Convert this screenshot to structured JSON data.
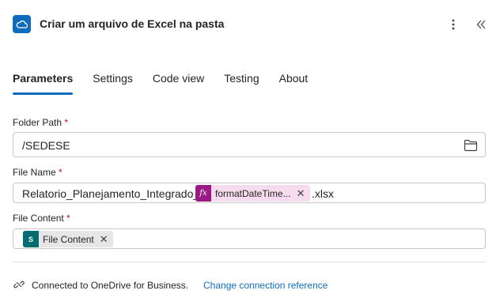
{
  "header": {
    "title": "Criar um arquivo de Excel na pasta",
    "app_icon": "onedrive-cloud-icon",
    "more_icon": "more-vertical-icon",
    "collapse_icon": "double-chevron-left-icon"
  },
  "tabs": [
    {
      "label": "Parameters",
      "active": true
    },
    {
      "label": "Settings",
      "active": false
    },
    {
      "label": "Code view",
      "active": false
    },
    {
      "label": "Testing",
      "active": false
    },
    {
      "label": "About",
      "active": false
    }
  ],
  "fields": {
    "folder_path": {
      "label": "Folder Path",
      "required_mark": "*",
      "value": "/SEDESE",
      "icon": "folder-icon"
    },
    "file_name": {
      "label": "File Name",
      "required_mark": "*",
      "prefix": "Relatorio_Planejamento_Integrado_",
      "token": {
        "badge": "fx",
        "label": "formatDateTime...",
        "remove": "✕"
      },
      "suffix": ".xlsx"
    },
    "file_content": {
      "label": "File Content",
      "required_mark": "*",
      "token": {
        "badge": "S",
        "label": "File Content",
        "remove": "✕"
      }
    }
  },
  "footer": {
    "connection_text": "Connected to OneDrive for Business.",
    "link_text": "Change connection reference",
    "icon": "connection-plug-icon"
  },
  "colors": {
    "accent": "#0f6cbd",
    "required": "#c50f1f",
    "fx_token_bg": "#f7dcef",
    "fx_badge": "#9b1a85",
    "sp_badge": "#036c70"
  }
}
